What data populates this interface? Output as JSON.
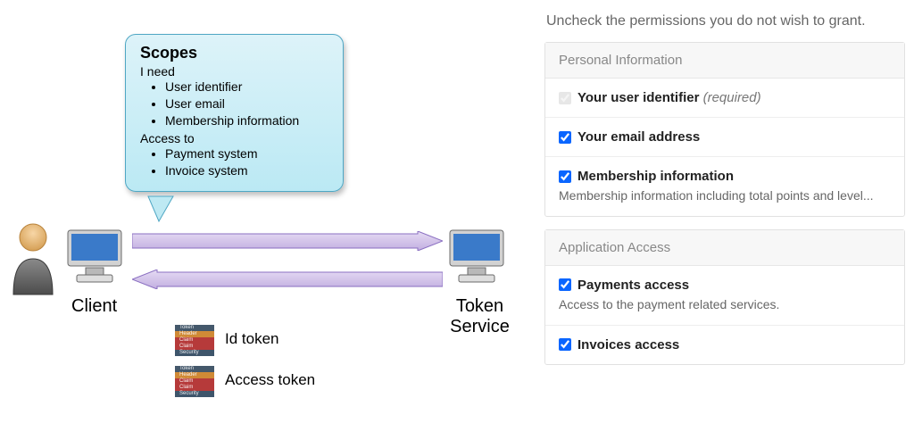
{
  "diagram": {
    "callout": {
      "title": "Scopes",
      "need_label": "I need",
      "need_items": [
        "User identifier",
        "User email",
        "Membership information"
      ],
      "access_label": "Access to",
      "access_items": [
        "Payment system",
        "Invoice system"
      ]
    },
    "client_label": "Client",
    "token_service_label": "Token Service",
    "tokens": [
      {
        "label": "Id token"
      },
      {
        "label": "Access token"
      }
    ],
    "token_box_rows": [
      "Token",
      "Header",
      "Claim",
      "Claim",
      "Security"
    ]
  },
  "permissions": {
    "instruction": "Uncheck the permissions you do not wish to grant.",
    "groups": [
      {
        "title": "Personal Information",
        "items": [
          {
            "label": "Your user identifier",
            "required_suffix": " (required)",
            "checked": true,
            "disabled": true,
            "desc": ""
          },
          {
            "label": "Your email address",
            "required_suffix": "",
            "checked": true,
            "disabled": false,
            "desc": ""
          },
          {
            "label": "Membership information",
            "required_suffix": "",
            "checked": true,
            "disabled": false,
            "desc": "Membership information including total points and level..."
          }
        ]
      },
      {
        "title": "Application Access",
        "items": [
          {
            "label": "Payments access",
            "required_suffix": "",
            "checked": true,
            "disabled": false,
            "desc": "Access to the payment related services."
          },
          {
            "label": "Invoices access",
            "required_suffix": "",
            "checked": true,
            "disabled": false,
            "desc": ""
          }
        ]
      }
    ]
  }
}
